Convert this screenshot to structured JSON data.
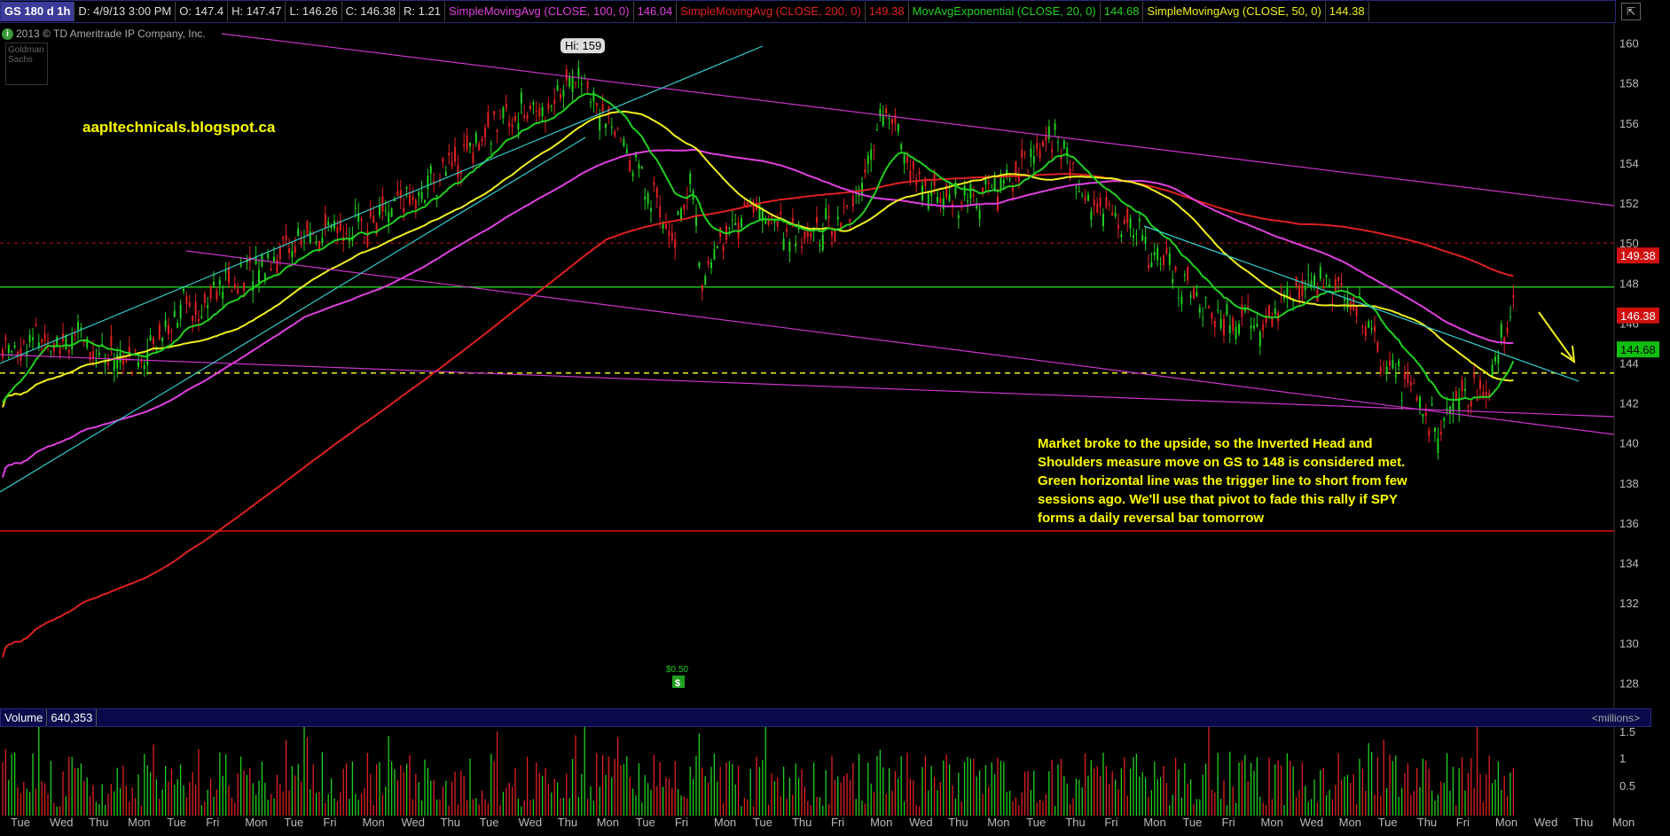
{
  "header": {
    "symbol": "GS 180 d 1h",
    "date": "D: 4/9/13 3:00 PM",
    "open": "O: 147.4",
    "high": "H: 147.47",
    "low": "L: 146.26",
    "close": "C: 146.38",
    "range": "R: 1.21",
    "studies": [
      {
        "label": "SimpleMovingAvg (CLOSE, 100, 0)",
        "value": "146.04",
        "color": "#e040e0"
      },
      {
        "label": "SimpleMovingAvg (CLOSE, 200, 0)",
        "value": "149.38",
        "color": "#e02020"
      },
      {
        "label": "MovAvgExponential (CLOSE, 20, 0)",
        "value": "144.68",
        "color": "#20d020"
      },
      {
        "label": "SimpleMovingAvg (CLOSE, 50, 0)",
        "value": "144.38",
        "color": "#f0f020"
      }
    ]
  },
  "copyright": "2013 © TD Ameritrade IP Company, Inc.",
  "logo_text": "Goldman Sachs",
  "blog": "aapltechnicals.blogspot.ca",
  "annotation": "Market broke to the upside, so the Inverted Head and Shoulders measure move on GS to 148 is considered met. Green horizontal line was the trigger line to short from few sessions ago. We'll use that pivot to fade this rally if SPY forms a daily reversal bar tomorrow",
  "volume": {
    "label": "Volume",
    "value": "640,353",
    "units": "<millions>"
  },
  "dividend_label": "$0.50",
  "dividend_icon": "dollar-icon",
  "chart_data": {
    "type": "line",
    "ylim": [
      127,
      161
    ],
    "yticks": [
      128,
      130,
      132,
      134,
      136,
      138,
      140,
      142,
      144,
      146,
      148,
      150,
      152,
      154,
      156,
      158,
      160
    ],
    "xticks": [
      "Tue",
      "Wed",
      "Thu",
      "Mon",
      "Tue",
      "Fri",
      "Mon",
      "Tue",
      "Fri",
      "Mon",
      "Wed",
      "Thu",
      "Tue",
      "Wed",
      "Thu",
      "Mon",
      "Tue",
      "Fri",
      "Mon",
      "Tue",
      "Thu",
      "Fri",
      "Mon",
      "Wed",
      "Thu",
      "Mon",
      "Tue",
      "Thu",
      "Fri",
      "Mon",
      "Tue",
      "Fri",
      "Mon",
      "Wed",
      "Mon",
      "Tue",
      "Thu",
      "Fri",
      "Mon",
      "Wed",
      "Thu",
      "Mon"
    ],
    "hi_label": "Hi: 159",
    "hi_value": 159,
    "levels": {
      "green_trigger": 147.8,
      "yellow_dashed": 143.5,
      "red_dashed": 150,
      "red_solid": 135.6
    },
    "price_flags": [
      {
        "value": "149.38",
        "price": 149.38,
        "bg": "#d01010",
        "fg": "#ffffff"
      },
      {
        "value": "146.38",
        "price": 146.38,
        "bg": "#d01010",
        "fg": "#ffffff"
      },
      {
        "value": "144.68",
        "price": 144.68,
        "bg": "#10c010",
        "fg": "#000000"
      }
    ],
    "volume_axis": {
      "ticks": [
        "1.5",
        "1",
        "0.5"
      ]
    },
    "colors": {
      "up": "#20d020",
      "down": "#e02020",
      "sma100": "#e040e0",
      "sma200": "#e02020",
      "ema20": "#20d020",
      "sma50": "#f0f020",
      "channel": "#cc33cc",
      "trend": "#33cccc"
    }
  }
}
